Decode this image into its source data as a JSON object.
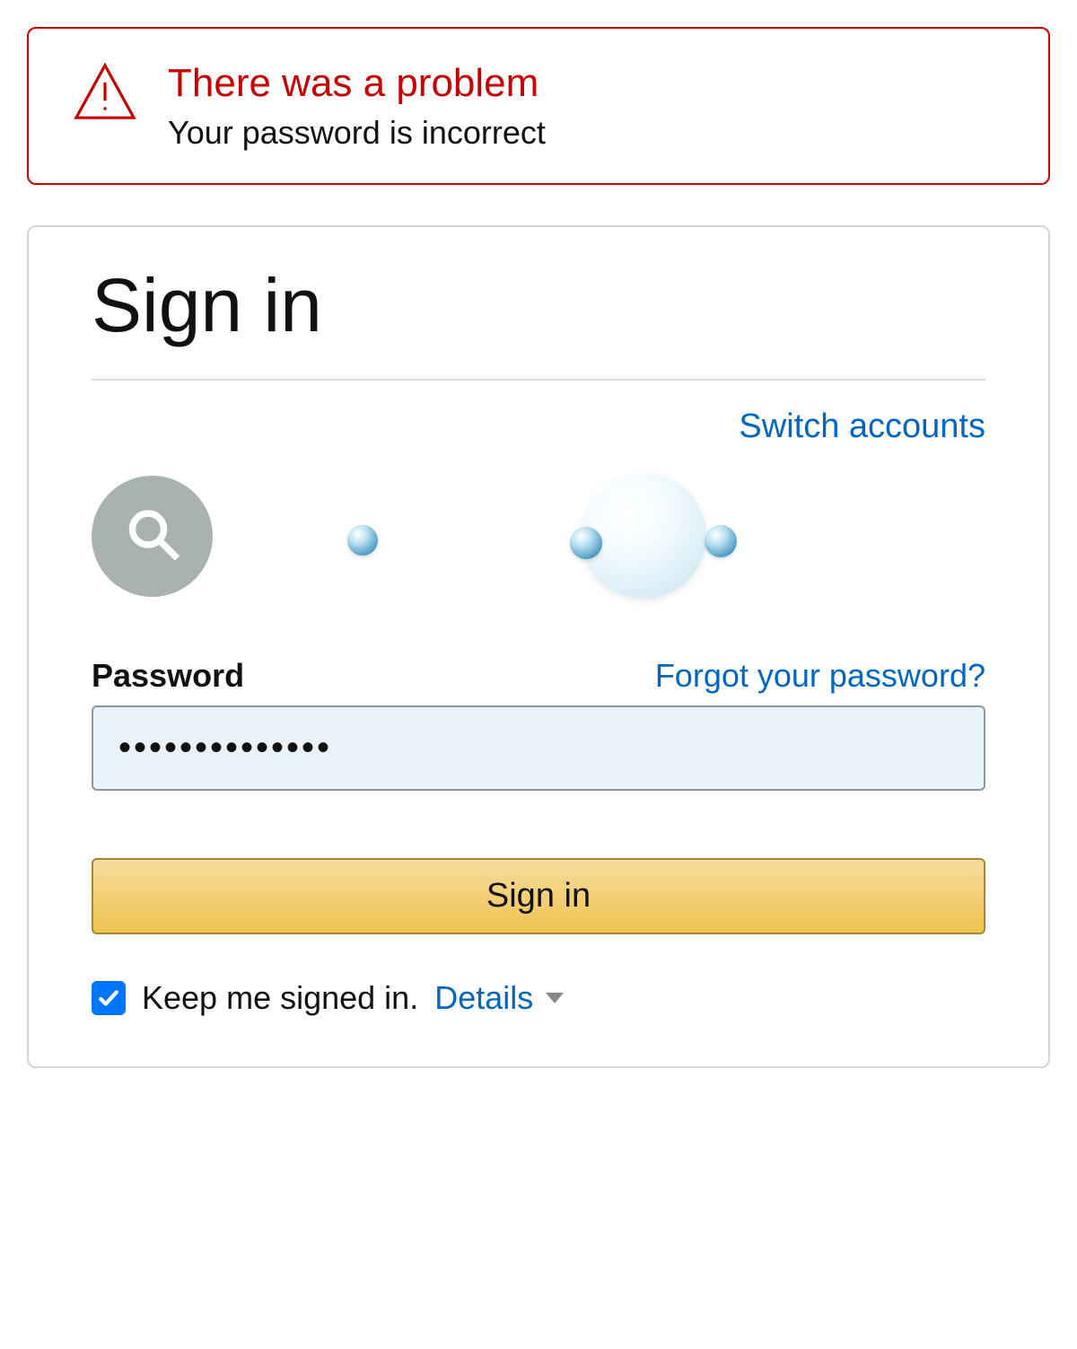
{
  "error": {
    "title": "There was a problem",
    "message": "Your password is incorrect"
  },
  "signin": {
    "heading": "Sign in",
    "switch_accounts": "Switch accounts",
    "password_label": "Password",
    "forgot_password": "Forgot your password?",
    "password_value": "••••••••••••••",
    "button_label": "Sign in",
    "keep_signed_in": "Keep me signed in.",
    "details_label": "Details",
    "keep_checked": true
  }
}
